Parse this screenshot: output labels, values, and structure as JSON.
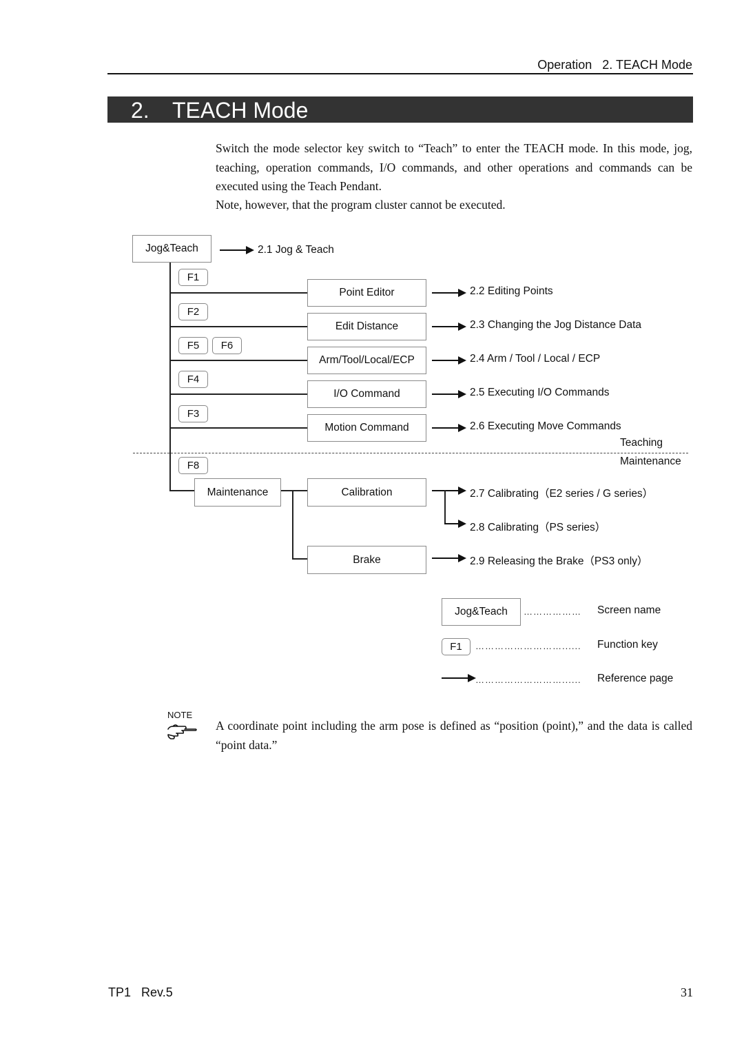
{
  "header": {
    "running_head": "Operation   2. TEACH Mode"
  },
  "section": {
    "number": "2.",
    "title": "TEACH Mode"
  },
  "intro": {
    "paragraph1": "Switch the mode selector key switch to “Teach” to enter the TEACH mode. In this mode, jog, teaching, operation commands, I/O commands, and other operations and commands can be executed using the Teach Pendant.",
    "paragraph2": "Note, however, that the program cluster cannot be executed."
  },
  "diagram": {
    "root": {
      "screen": "Jog&Teach",
      "ref": "2.1 Jog & Teach"
    },
    "branches": [
      {
        "keys": [
          "F1"
        ],
        "screen": "Point Editor",
        "ref": "2.2 Editing Points"
      },
      {
        "keys": [
          "F2"
        ],
        "screen": "Edit Distance",
        "ref": "2.3 Changing the Jog Distance Data"
      },
      {
        "keys": [
          "F5",
          "F6"
        ],
        "screen": "Arm/Tool/Local/ECP",
        "ref": "2.4 Arm / Tool / Local / ECP"
      },
      {
        "keys": [
          "F4"
        ],
        "screen": "I/O Command",
        "ref": "2.5 Executing I/O Commands"
      },
      {
        "keys": [
          "F3"
        ],
        "screen": "Motion Command",
        "ref": "2.6 Executing Move Commands"
      }
    ],
    "zones": {
      "upper": "Teaching",
      "lower": "Maintenance"
    },
    "maintenance": {
      "key": "F8",
      "screen": "Maintenance",
      "calibration": {
        "screen": "Calibration",
        "refs": [
          "2.7 Calibrating（E2 series / G series）",
          "2.8 Calibrating（PS series）"
        ]
      },
      "brake": {
        "screen": "Brake",
        "ref": "2.9 Releasing the Brake（PS3 only）"
      }
    },
    "legend": [
      {
        "symbol": "Jog&Teach",
        "dots": "………………",
        "meaning": "Screen name"
      },
      {
        "symbol": "F1",
        "dots": "………………………......",
        "meaning": "Function key"
      },
      {
        "symbol": "arrow",
        "dots": "………………………......",
        "meaning": "Reference page"
      }
    ]
  },
  "note": {
    "label": "NOTE",
    "icon": "pointing-hand-icon",
    "text": "A coordinate point including the arm pose is defined as “position (point),” and the data is called “point data.”"
  },
  "footer": {
    "doc_id": "TP1   Rev.5",
    "page_number": "31"
  }
}
